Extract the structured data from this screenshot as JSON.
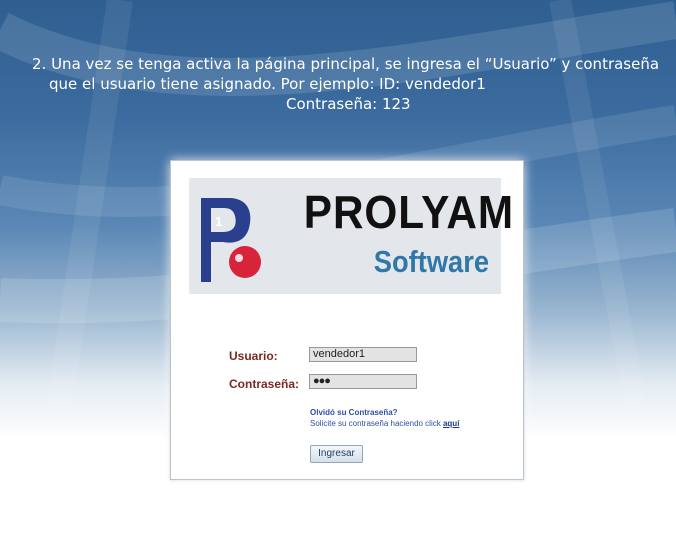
{
  "instruction": {
    "line1": "2.  Una vez se tenga activa la página principal, se ingresa el “Usuario” y contraseña",
    "line2": "que el usuario tiene asignado. Por ejemplo: ID: vendedor1",
    "line3": "Contraseña: 123"
  },
  "login": {
    "logo": {
      "brand": "PROLYAM",
      "subtitle": "Software"
    },
    "usuario_label": "Usuario:",
    "usuario_value": "vendedor1",
    "password_label": "Contraseña:",
    "password_value": "●●●",
    "forgot_title": "Olvidó su Contraseña?",
    "forgot_text": "Solicite su contraseña haciendo click ",
    "forgot_link": "aquí",
    "submit_label": "Ingresar"
  },
  "colors": {
    "label": "#7a2a20",
    "link": "#2b4fa3",
    "brand_blue": "#2f78a8",
    "logo_p": "#2b3f8f",
    "logo_dot": "#d8243a"
  }
}
